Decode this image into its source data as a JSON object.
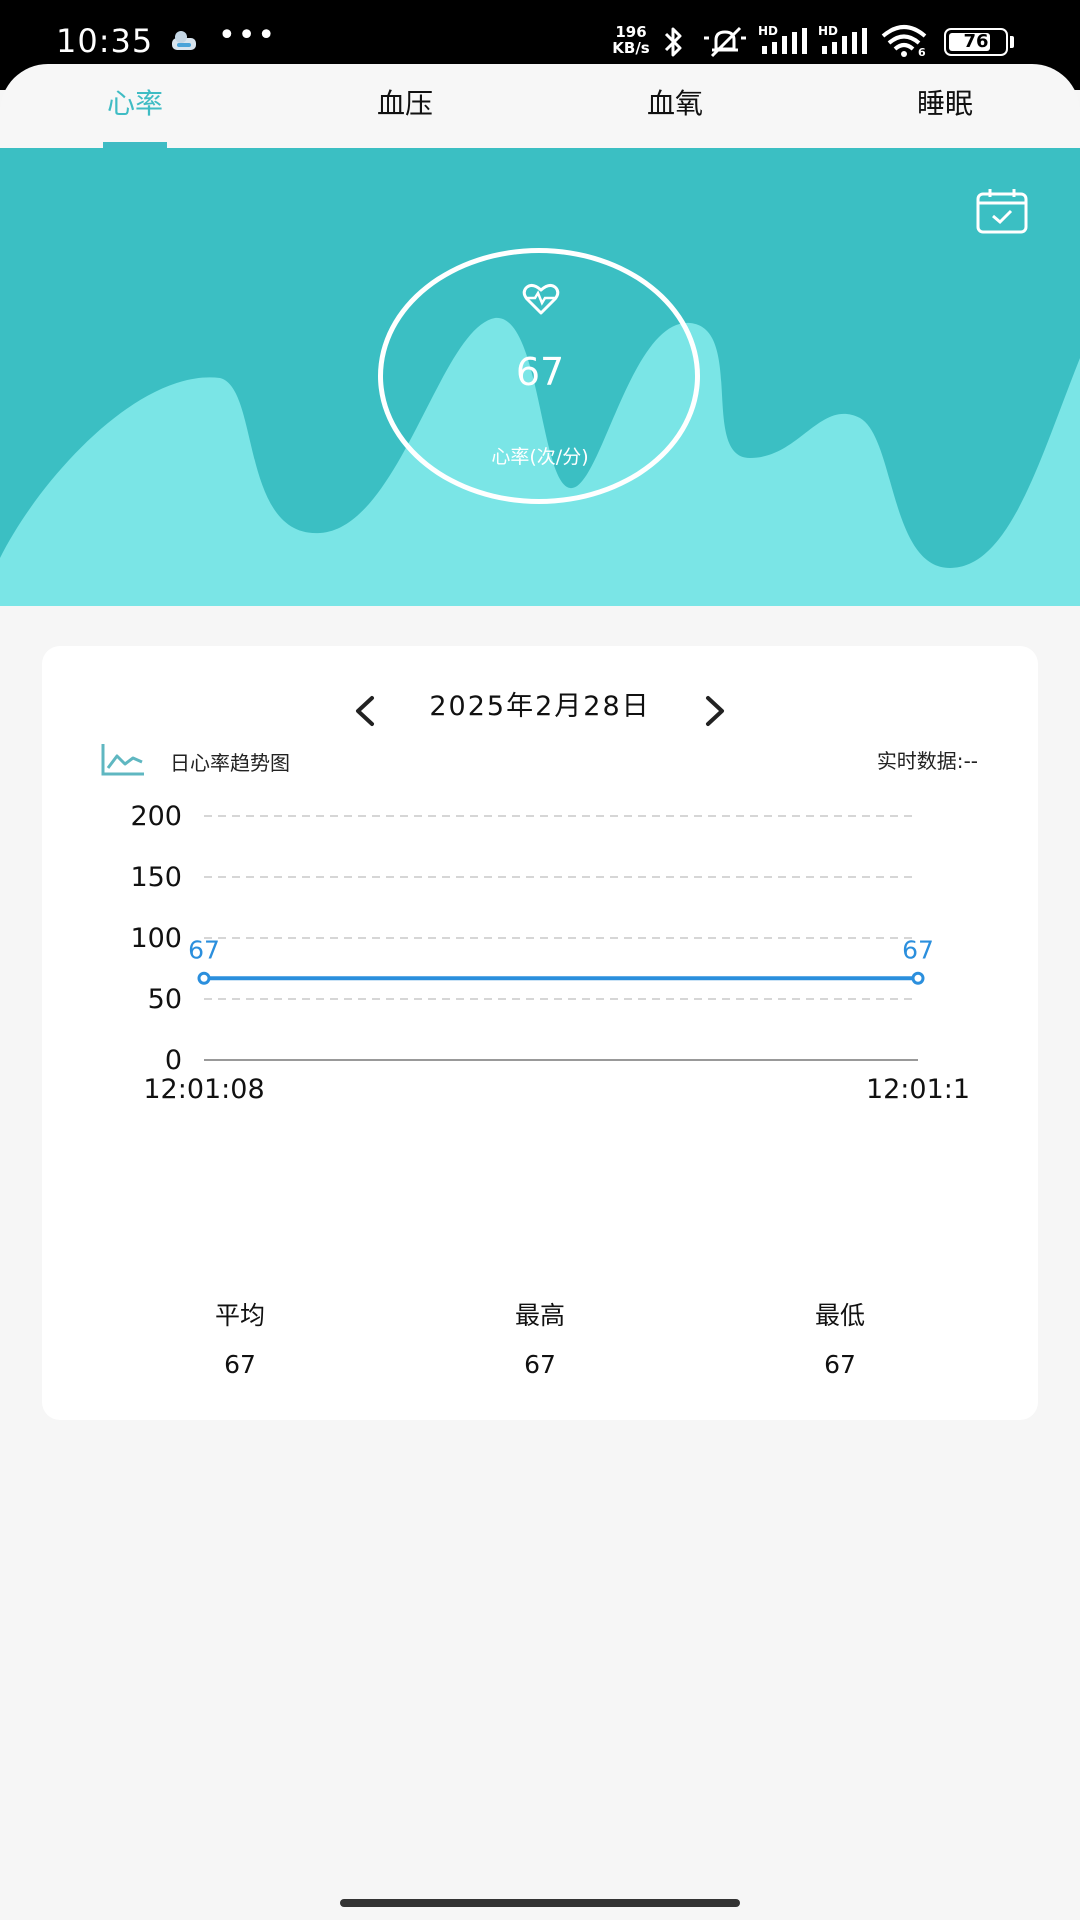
{
  "status_bar": {
    "time": "10:35",
    "dots": "•••",
    "net_speed_value": "196",
    "net_speed_unit": "KB/s",
    "hd_1": "HD",
    "hd_2": "HD",
    "wifi_badge": "6",
    "battery": "76",
    "battery_level": 0.76
  },
  "tabs": [
    {
      "label": "心率",
      "active": true
    },
    {
      "label": "血压",
      "active": false
    },
    {
      "label": "血氧",
      "active": false
    },
    {
      "label": "睡眠",
      "active": false
    }
  ],
  "hero": {
    "value": "67",
    "unit": "心率(次/分)",
    "colors": {
      "dark": "#3bbfc3",
      "light": "#7ae5e6",
      "ring": "#ffffff"
    },
    "icons": {
      "heart": "heart-pulse-icon",
      "calendar": "calendar-check-icon"
    }
  },
  "card": {
    "date": "2025年2月28日",
    "chart_title": "日心率趋势图",
    "realtime_label": "实时数据: ",
    "realtime_value": "--",
    "stats": [
      {
        "label": "平均",
        "value": "67"
      },
      {
        "label": "最高",
        "value": "67"
      },
      {
        "label": "最低",
        "value": "67"
      }
    ]
  },
  "chart_data": {
    "type": "line",
    "x": [
      "12:01:08",
      "12:01:1"
    ],
    "series": [
      {
        "values": [
          67,
          67
        ],
        "data_labels": [
          "67",
          "67"
        ],
        "color": "#2b8fdd"
      }
    ],
    "yticks": [
      0,
      50,
      100,
      150,
      200
    ],
    "ylim": [
      0,
      200
    ],
    "grid": true,
    "grid_style": "dashed"
  }
}
